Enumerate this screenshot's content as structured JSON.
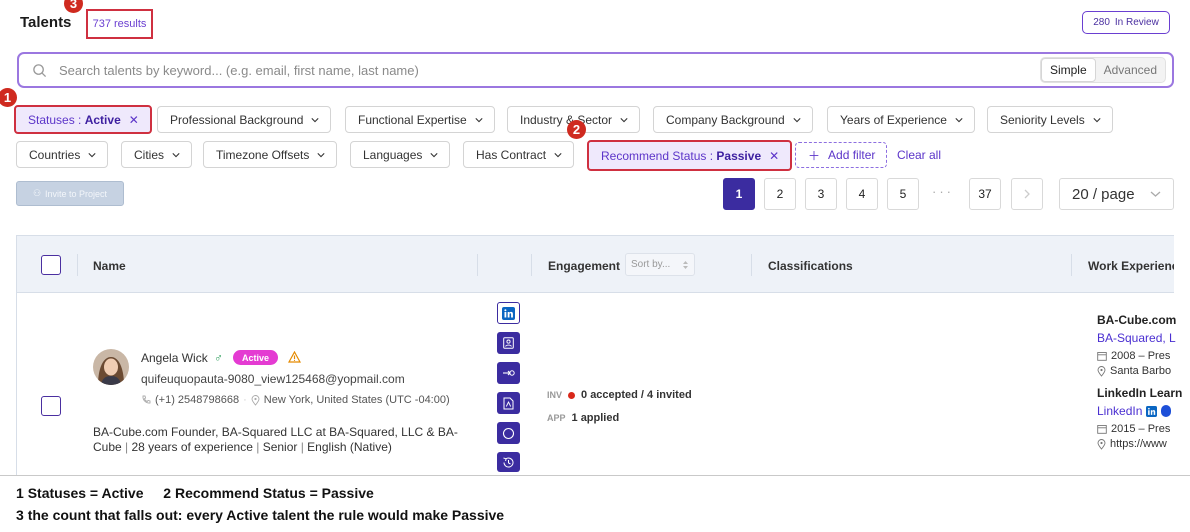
{
  "header": {
    "title": "Talents",
    "results_count": "737 results",
    "in_review_count": "280",
    "in_review_label": "In Review"
  },
  "search": {
    "placeholder": "Search talents by keyword... (e.g. email, first name, last name)",
    "mode_simple": "Simple",
    "mode_advanced": "Advanced",
    "active_mode": "Simple"
  },
  "filters": {
    "statuses_label": "Statuses :",
    "statuses_value": "Active",
    "row1": [
      "Professional Background",
      "Functional Expertise",
      "Industry & Sector",
      "Company Background",
      "Years of Experience",
      "Seniority Levels"
    ],
    "row2": [
      "Countries",
      "Cities",
      "Timezone Offsets",
      "Languages",
      "Has Contract"
    ],
    "recommend_label": "Recommend Status :",
    "recommend_value": "Passive",
    "add_filter": "Add filter",
    "clear_all": "Clear all"
  },
  "callouts": {
    "one": "1",
    "two": "2",
    "three": "3"
  },
  "toolbar": {
    "invite_label": "Invite to Project"
  },
  "pagination": {
    "pages": [
      "1",
      "2",
      "3",
      "4",
      "5"
    ],
    "current": "1",
    "ellipsis": "···",
    "last": "37",
    "per_page": "20 / page"
  },
  "table": {
    "col_name": "Name",
    "col_engagement": "Engagement",
    "sort_placeholder": "Sort by...",
    "col_classifications": "Classifications",
    "col_work": "Work Experience"
  },
  "row": {
    "name": "Angela Wick",
    "status": "Active",
    "email": "quifeuquopauta-9080_view125468@yopmail.com",
    "phone": "(+1) 2548798668",
    "location": "New York, United States (UTC -04:00)",
    "summary_line1": "BA-Cube.com Founder, BA-Squared LLC at BA-Squared, LLC & BA-",
    "summary_line2_company": "Cube",
    "years": "28 years of experience",
    "seniority": "Senior",
    "language": "English (Native)",
    "inv_tag": "INV",
    "inv_value": "0 accepted / 4 invited",
    "app_tag": "APP",
    "app_value": "1 applied",
    "work": [
      {
        "company": "BA-Cube.com",
        "role": "BA-Squared, L",
        "dates": "2008 – Pres",
        "place": "Santa Barbo"
      },
      {
        "company": "LinkedIn Learn",
        "role": "LinkedIn",
        "dates": "2015 – Pres",
        "place": "https://www"
      }
    ]
  },
  "captions": {
    "line1_n1": "1",
    "line1_t1": "Statuses = Active",
    "line1_n2": "2",
    "line1_t2": "Recommend Status = Passive",
    "line2_n": "3",
    "line2_t": "the count that falls out: every Active talent the rule would make Passive"
  },
  "colors": {
    "accent": "#3b2ca0",
    "highlight_red": "#cf3040",
    "active_pill": "#e43bd2"
  }
}
